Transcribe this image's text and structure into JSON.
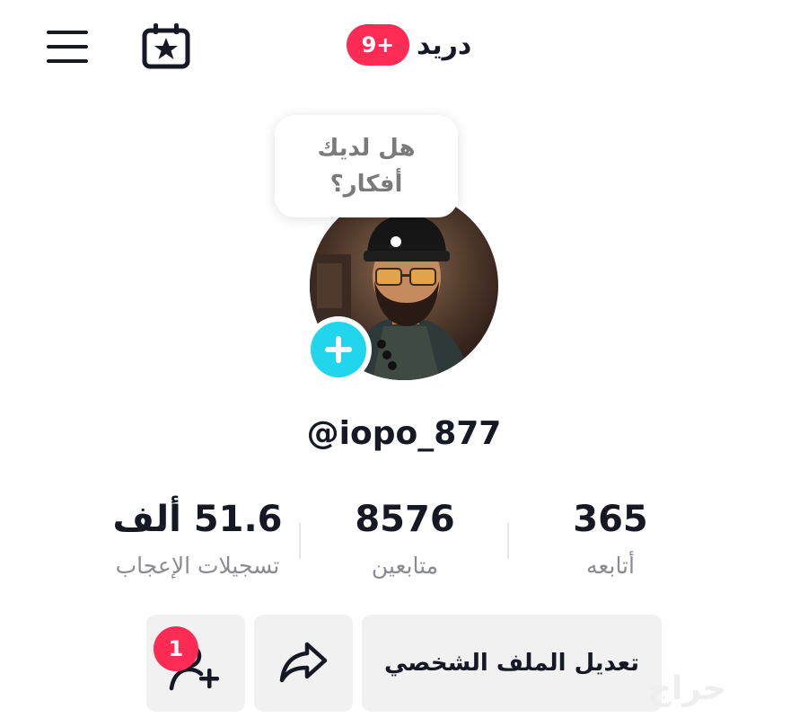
{
  "header": {
    "title": "دريد",
    "notification_badge": "9+"
  },
  "bubble": {
    "line1": "هل لديك",
    "line2": "أفكار؟"
  },
  "profile": {
    "username": "@iopo_877"
  },
  "stats": [
    {
      "value": "365",
      "label": "أتابعه"
    },
    {
      "value": "8576",
      "label": "متابعين"
    },
    {
      "value": "51.6 ألف",
      "label": "تسجيلات الإعجاب"
    }
  ],
  "actions": {
    "edit_profile_label": "تعديل الملف الشخصي",
    "friend_requests_count": "1"
  },
  "watermark": {
    "text": "حراج"
  },
  "colors": {
    "accent_red": "#fe2c55",
    "avatar_add_cyan": "#20d5ec",
    "button_bg": "#f1f1f2",
    "muted_text": "#8a8b91"
  },
  "icons": {
    "menu": "menu-icon",
    "calendar": "calendar-star-icon",
    "add_avatar": "plus-icon",
    "share": "share-arrow-icon",
    "add_friend": "add-user-icon"
  }
}
